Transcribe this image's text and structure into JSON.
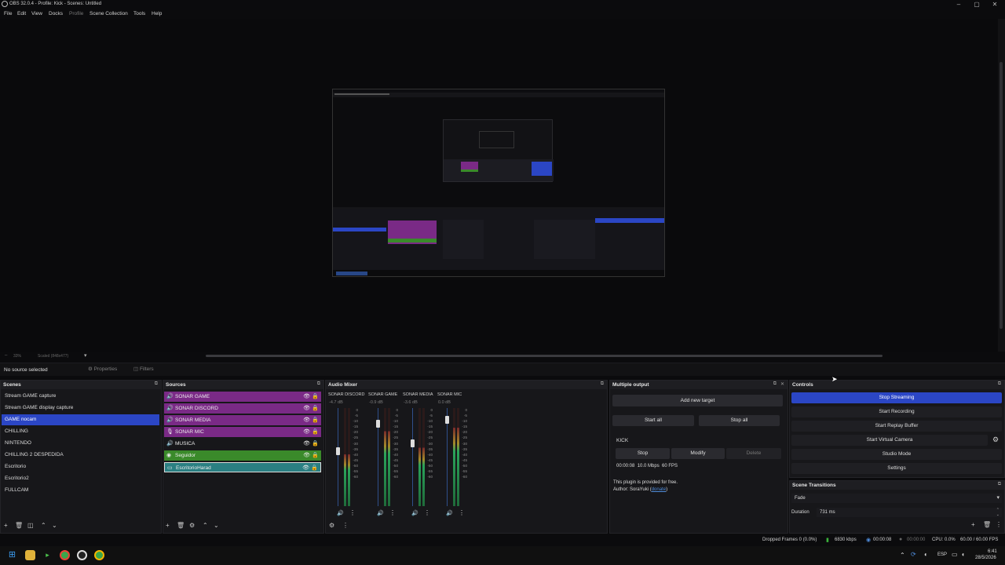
{
  "window": {
    "title": "OBS 32.0.4 - Profile: Kick - Scenes: Untitled"
  },
  "menu": {
    "file": "File",
    "edit": "Edit",
    "view": "View",
    "docks": "Docks",
    "profile": "Profile",
    "scene_collection": "Scene Collection",
    "tools": "Tools",
    "help": "Help"
  },
  "preview": {
    "zoom": "33%",
    "scale": "Scaled (848x477)"
  },
  "infobar": {
    "no_source": "No source selected",
    "properties": "Properties",
    "filters": "Filters"
  },
  "scenes": {
    "title": "Scenes",
    "items": [
      "Stream GAME capture",
      "Stream GAME display capture",
      "GAME nocam",
      "CHILLING",
      "NINTENDO",
      "CHILLING 2 DESPEDIDA",
      "Escritorio",
      "Escritorio2",
      "FULLCAM"
    ],
    "selected": "GAME nocam"
  },
  "sources": {
    "title": "Sources",
    "items": [
      {
        "name": "SONAR GAME",
        "icon": "speaker-icon",
        "color": "#7a2a86"
      },
      {
        "name": "SONAR DISCORD",
        "icon": "speaker-icon",
        "color": "#7a2a86"
      },
      {
        "name": "SONAR MEDIA",
        "icon": "speaker-icon",
        "color": "#7a2a86"
      },
      {
        "name": "SONAR MIC",
        "icon": "microphone-icon",
        "color": "#7a2a86"
      },
      {
        "name": "MUSICA",
        "icon": "speaker-icon",
        "color": "#17171a"
      },
      {
        "name": "Seguidor",
        "icon": "globe-icon",
        "color": "#3a8a2a"
      },
      {
        "name": "EscritorioHarad",
        "icon": "monitor-icon",
        "color": "#2a7f82"
      }
    ]
  },
  "mixer": {
    "title": "Audio Mixer",
    "channels": [
      {
        "name": "SONAR DISCORD",
        "db": "-4.7 dB",
        "level": 0.62
      },
      {
        "name": "SONAR GAME",
        "db": "-0.9 dB",
        "level": 0.9
      },
      {
        "name": "SONAR MEDIA",
        "db": "-3.6 dB",
        "level": 0.7
      },
      {
        "name": "SONAR MIC",
        "db": "0.0 dB",
        "level": 0.94
      }
    ],
    "scale": [
      "0",
      "-5",
      "-10",
      "-15",
      "-20",
      "-25",
      "-30",
      "-35",
      "-40",
      "-45",
      "-50",
      "-55",
      "-60"
    ]
  },
  "multiple_output": {
    "title": "Multiple output",
    "add_target": "Add new target",
    "start_all": "Start all",
    "stop_all": "Stop all",
    "target_name": "KICK",
    "stop": "Stop",
    "modify": "Modify",
    "delete": "Delete",
    "stats": "00:00:08  10.0 Mbps  60 FPS",
    "plugin_note": "This plugin is provided for free.",
    "author_prefix": "Author: SoraYuki (",
    "author_link": "donate",
    "author_suffix": ")"
  },
  "controls": {
    "title": "Controls",
    "stop_streaming": "Stop Streaming",
    "start_recording": "Start Recording",
    "start_replay": "Start Replay Buffer",
    "start_virtual_cam": "Start Virtual Camera",
    "studio_mode": "Studio Mode",
    "settings": "Settings",
    "accent": "#2b46c5"
  },
  "transitions": {
    "title": "Scene Transitions",
    "type": "Fade",
    "duration_label": "Duration",
    "duration_value": "731 ms"
  },
  "status": {
    "dropped": "Dropped Frames 0 (0.0%)",
    "kbps": "6830 kbps",
    "stream_time": "00:00:08",
    "rec_time": "00:00:00",
    "cpu": "CPU: 0.0%",
    "fps": "60.00 / 60.00 FPS"
  },
  "taskbar": {
    "lang": "ESP",
    "time": "6:41",
    "date": "28/5/2026"
  }
}
